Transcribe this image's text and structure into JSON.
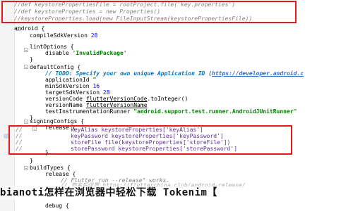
{
  "lines": {
    "l1": "//def keystorePropertiesFile = rootProject.file('key.properties')",
    "l2": "//def keystoreProperties = new Properties()",
    "l3": "//keystoreProperties.load(new FileInputStream(keystorePropertiesFile))",
    "android": "android {",
    "compileSdk_k": "compileSdkVersion",
    "compileSdk_v": "28",
    "lintOptions": "lintOptions {",
    "disable_k": "disable",
    "disable_v": "'InvalidPackage'",
    "close_brace": "}",
    "defaultConfig": "defaultConfig {",
    "todo_prefix": "// TODO: Specify your own unique Application ID (",
    "todo_link": "https://developer.android.c",
    "appId_k": "applicationId",
    "appId_v": "\"",
    "minSdk_k": "minSdkVersion",
    "minSdk_v": "16",
    "targetSdk_k": "targetSdkVersion",
    "targetSdk_v": "28",
    "versionCode_k": "versionCode",
    "versionCode_v1": "flutterVersionCode",
    "versionCode_v2": ".toInteger()",
    "versionName_k": "versionName",
    "versionName_v": "flutterVersionName",
    "testRunner_k": "testInstrumentationRunner",
    "testRunner_v": "\"android.support.test.runner.AndroidJUnitRunner\"",
    "signingConfigs": "signingConfigs {",
    "release": "release {",
    "keyAlias": "keyAlias keystoreProperties['keyAlias']",
    "keyPassword": "keyPassword keystoreProperties['keyPassword']",
    "storeFile": "storeFile file(keystoreProperties['storeFile'])",
    "storePassword": "storePassword keystoreProperties['storePassword']",
    "comment_marker": "//",
    "buildTypes": "buildTypes {",
    "release2": "release {",
    "flutterRun": "// Flutter run --release\" works.",
    "signingCfg": "// 签名后位置 https://flutterchina.club/android-release/",
    "debug": "debug {"
  },
  "overlay": {
    "title": "bianoti怎样在浏览器中轻松下载 Tokenim【"
  },
  "colors": {
    "highlight_border": "#e01b1b",
    "keyword": "#000080",
    "string": "#008000",
    "comment": "#808080"
  }
}
